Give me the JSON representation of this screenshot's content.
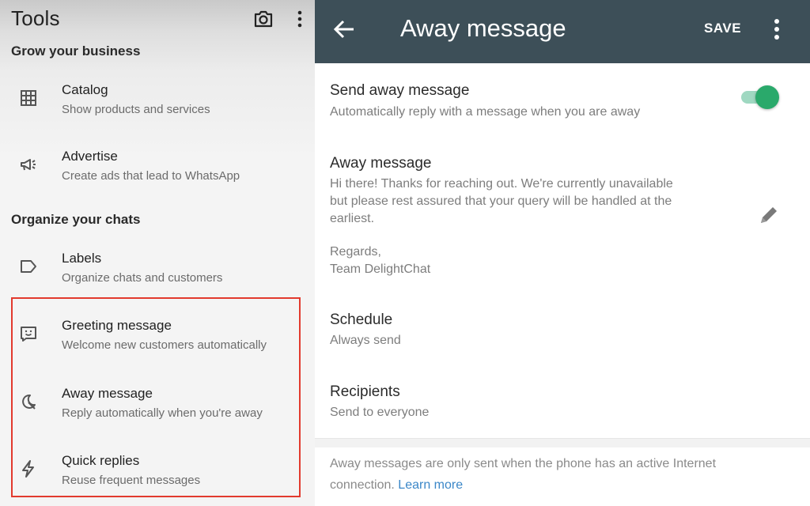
{
  "tools": {
    "title": "Tools",
    "sections": [
      {
        "title": "Grow your business",
        "items": [
          {
            "icon": "catalog-icon",
            "title": "Catalog",
            "subtitle": "Show products and services"
          },
          {
            "icon": "megaphone-icon",
            "title": "Advertise",
            "subtitle": "Create ads that lead to WhatsApp"
          }
        ]
      },
      {
        "title": "Organize your chats",
        "items": [
          {
            "icon": "label-icon",
            "title": "Labels",
            "subtitle": "Organize chats and customers"
          },
          {
            "icon": "greeting-icon",
            "title": "Greeting message",
            "subtitle": "Welcome new customers automatically"
          },
          {
            "icon": "away-icon",
            "title": "Away message",
            "subtitle": "Reply automatically when you're away"
          },
          {
            "icon": "lightning-icon",
            "title": "Quick replies",
            "subtitle": "Reuse frequent messages"
          }
        ]
      }
    ],
    "highlight_color": "#e23a2e"
  },
  "away": {
    "title": "Away message",
    "save_label": "SAVE",
    "appbar_color": "#3d4f58",
    "send": {
      "title": "Send away message",
      "subtitle": "Automatically reply with a message when you are away",
      "enabled": true,
      "toggle_color": "#2aa96b"
    },
    "message": {
      "title": "Away message",
      "line1": "Hi there! Thanks for reaching out. We're currently unavailable",
      "line2": "but please rest assured that your query will be handled at the",
      "line3": "earliest.",
      "line4": "Regards,",
      "line5": "Team DelightChat"
    },
    "schedule": {
      "title": "Schedule",
      "value": "Always send"
    },
    "recipients": {
      "title": "Recipients",
      "value": "Send to everyone"
    },
    "footnote": {
      "line1": "Away messages are only sent when the phone has an active Internet",
      "line2": "connection.",
      "link": "Learn more",
      "link_color": "#3b87c8"
    }
  }
}
